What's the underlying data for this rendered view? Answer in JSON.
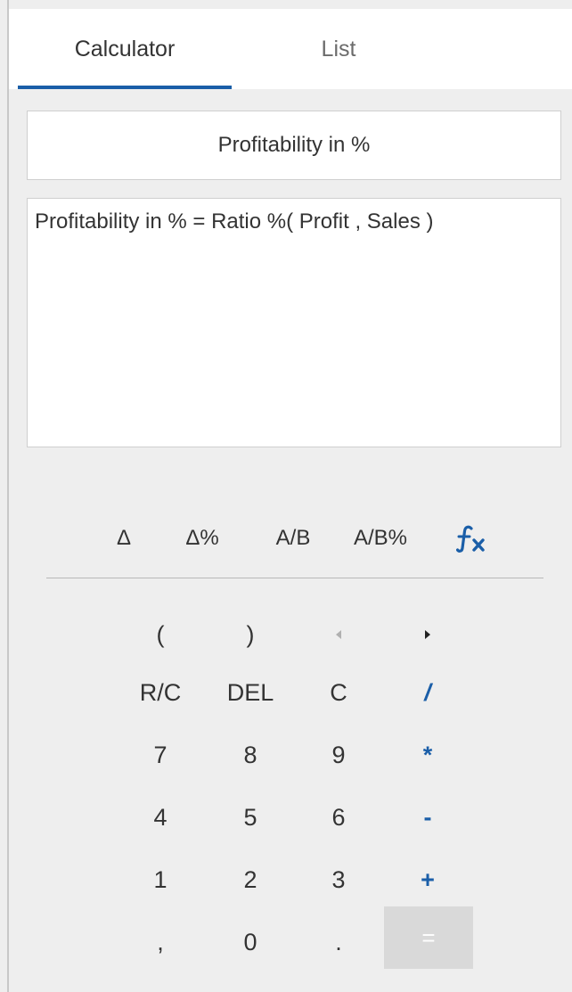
{
  "tabs": {
    "calculator": "Calculator",
    "list": "List"
  },
  "measure_name": "Profitability in %",
  "formula": "Profitability in % = Ratio %( Profit , Sales )",
  "operations": {
    "delta": "Δ",
    "delta_pct": "Δ%",
    "ratio": "A/B",
    "ratio_pct": "A/B%",
    "function_icon": "fx-icon"
  },
  "keypad": {
    "open_paren": "(",
    "close_paren": ")",
    "cursor_left_icon": "caret-left-icon",
    "cursor_right_icon": "caret-right-icon",
    "rc": "R/C",
    "del": "DEL",
    "clear": "C",
    "divide": "/",
    "seven": "7",
    "eight": "8",
    "nine": "9",
    "multiply": "*",
    "four": "4",
    "five": "5",
    "six": "6",
    "minus": "-",
    "one": "1",
    "two": "2",
    "three": "3",
    "plus": "+",
    "comma": ",",
    "zero": "0",
    "decimal": ".",
    "equals": "="
  },
  "colors": {
    "accent": "#1a5ea8",
    "background": "#eeeeee",
    "equals_bg": "#d9d9d9"
  }
}
